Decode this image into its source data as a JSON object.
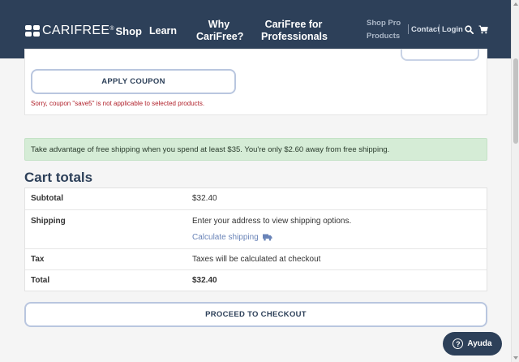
{
  "header": {
    "logo_text": "CARIFREE",
    "logo_reg": "®",
    "logo_shop": "Shop",
    "nav": {
      "learn": "Learn",
      "why_line1": "Why",
      "why_line2": "CariFree?",
      "pro_line1": "CariFree for",
      "pro_line2": "Professionals",
      "shop_pro_line1": "Shop Pro",
      "shop_pro_line2": "Products",
      "contact": "Contact",
      "login": "Login"
    },
    "background": "#2d4059"
  },
  "coupon": {
    "apply_label": "APPLY COUPON",
    "error_message": "Sorry, coupon \"save5\" is not applicable to selected products."
  },
  "notice": {
    "text": "Take advantage of free shipping when you spend at least $35. You're only $2.60 away from free shipping."
  },
  "cart_totals": {
    "title": "Cart totals",
    "rows": [
      {
        "label": "Subtotal",
        "value": "$32.40"
      },
      {
        "label": "Shipping",
        "value": "Enter your address to view shipping options.",
        "link": "Calculate shipping"
      },
      {
        "label": "Tax",
        "value": "Taxes will be calculated at checkout"
      },
      {
        "label": "Total",
        "value": "$32.40"
      }
    ]
  },
  "checkout": {
    "label": "PROCEED TO CHECKOUT"
  },
  "help": {
    "label": "Ayuda",
    "icon_glyph": "?"
  },
  "colors": {
    "brand": "#2d4059",
    "notice_bg": "#d5ecd6",
    "error": "#b0202a",
    "link": "#6a84b8"
  }
}
